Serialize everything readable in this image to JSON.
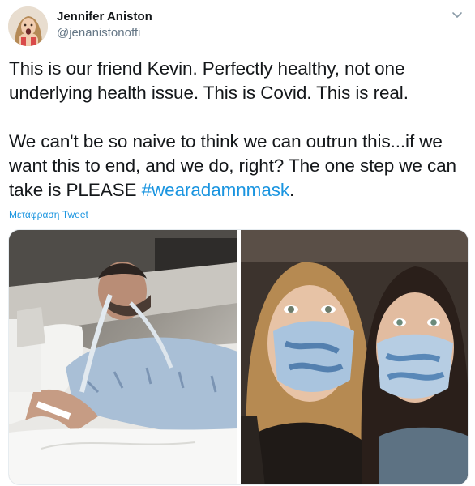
{
  "author": {
    "name": "Jennifer Aniston",
    "handle": "@jenanistonoffi",
    "avatar_icon": "avatar-photo"
  },
  "tweet": {
    "line1": "This is our friend Kevin. Perfectly healthy, not one underlying health issue. This is Covid. This is real.",
    "line2_prefix": "We can't be so naive to think we can outrun this...if we want this to end, and we do, right? The one step we can take is PLEASE ",
    "hashtag": "#wearadamnmask",
    "line2_suffix": ".",
    "translate_label": "Μετάφραση Tweet"
  },
  "media": {
    "photos": [
      {
        "icon": "hospital-photo"
      },
      {
        "icon": "masked-selfie-photo"
      }
    ]
  },
  "colors": {
    "link": "#1b95e0",
    "text": "#14171a",
    "secondary": "#657786"
  },
  "icons": {
    "menu": "chevron-down-icon"
  }
}
